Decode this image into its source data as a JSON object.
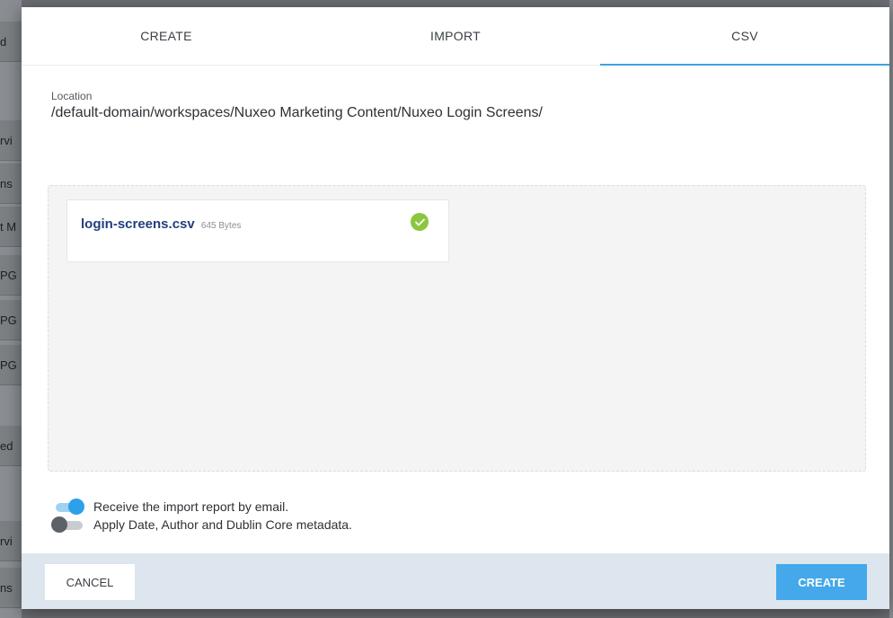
{
  "background": {
    "fragments": [
      "d",
      "rvi",
      "ns",
      "t M",
      "PG",
      "PG",
      "PG",
      "ed",
      "rvi",
      "ns"
    ]
  },
  "tabs": [
    {
      "label": "CREATE",
      "active": false
    },
    {
      "label": "IMPORT",
      "active": false
    },
    {
      "label": "CSV",
      "active": true
    }
  ],
  "location": {
    "label": "Location",
    "path": "/default-domain/workspaces/Nuxeo Marketing Content/Nuxeo Login Screens/"
  },
  "upload": {
    "file_name": "login-screens.csv",
    "file_size": "645 Bytes",
    "status_icon": "check-circle-icon"
  },
  "options": [
    {
      "label": "Receive the import report by email.",
      "enabled": true
    },
    {
      "label": "Apply Date, Author and Dublin Core metadata.",
      "enabled": false
    }
  ],
  "footer": {
    "cancel_label": "CANCEL",
    "create_label": "CREATE"
  },
  "colors": {
    "accent": "#3ca3e2",
    "success": "#8cc63f",
    "file_link": "#213f7d",
    "footer_bg": "#dde5ee"
  }
}
